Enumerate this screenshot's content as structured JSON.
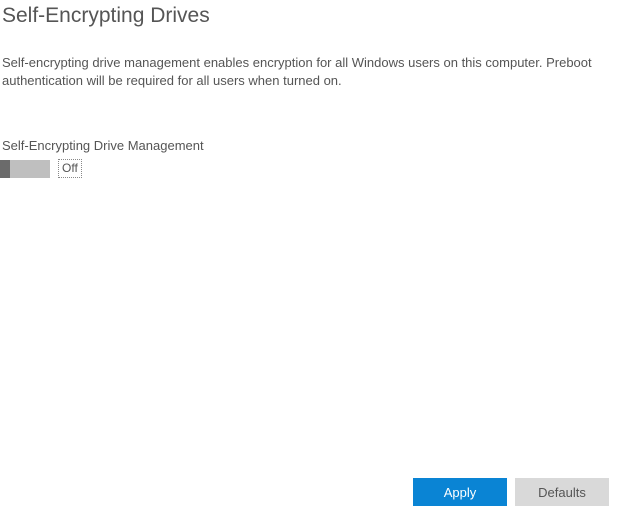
{
  "header": {
    "title": "Self-Encrypting Drives"
  },
  "description": {
    "text": "Self-encrypting drive management enables encryption for all Windows users on this computer. Preboot authentication will be required for all users when turned on."
  },
  "section": {
    "label": "Self-Encrypting Drive Management",
    "toggle_state": "Off"
  },
  "buttons": {
    "apply": "Apply",
    "defaults": "Defaults"
  }
}
